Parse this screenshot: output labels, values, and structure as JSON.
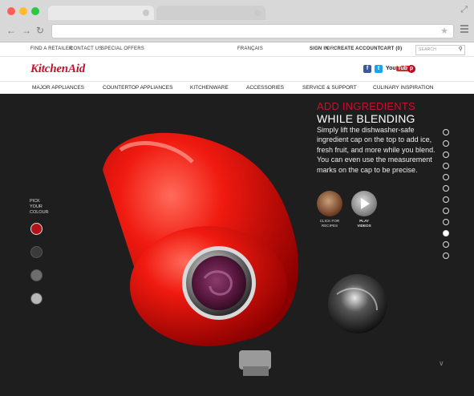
{
  "browser": {
    "window_dots": [
      "#ff5f57",
      "#febc2e",
      "#28c840"
    ],
    "url": ""
  },
  "utility_bar": {
    "find_retailer": "FIND A RETAILER",
    "contact_us": "CONTACT US",
    "special_offers": "SPECIAL OFFERS",
    "language": "FRANÇAIS",
    "sign_in": "SIGN IN",
    "or": "OR",
    "create_account": "CREATE ACCOUNT",
    "cart": "CART (0)",
    "search_placeholder": "SEARCH"
  },
  "brand": {
    "logo": "KitchenAid",
    "accent": "#c8102e",
    "social_facebook": "f",
    "social_twitter": "t",
    "social_youtube_a": "You",
    "social_youtube_b": "Tube",
    "social_pinterest": "p"
  },
  "main_nav": [
    "MAJOR APPLIANCES",
    "COUNTERTOP APPLIANCES",
    "KITCHENWARE",
    "ACCESSORIES",
    "SERVICE & SUPPORT",
    "CULINARY INSPIRATION"
  ],
  "color_picker": {
    "label_line1": "PICK",
    "label_line2": "YOUR",
    "label_line3": "COLOUR",
    "swatches": [
      "#b3121a",
      "#3a3a3a",
      "#6e6e6e",
      "#b8b8b8"
    ],
    "selected_index": 0
  },
  "feature": {
    "headline_line1": "ADD INGREDIENTS",
    "headline_line2": "WHILE BLENDING",
    "body": "Simply lift the dishwasher-safe ingredient cap on the top to add ice, fresh fruit, and more while you blend. You can even use the measurement marks on the cap to be precise.",
    "recipes_label_line1": "CLICK FOR",
    "recipes_label_line2": "RECIPES",
    "videos_label_line1": "PLAY",
    "videos_label_line2": "VIDEOS"
  },
  "pagination": {
    "total": 12,
    "active_index": 9
  }
}
